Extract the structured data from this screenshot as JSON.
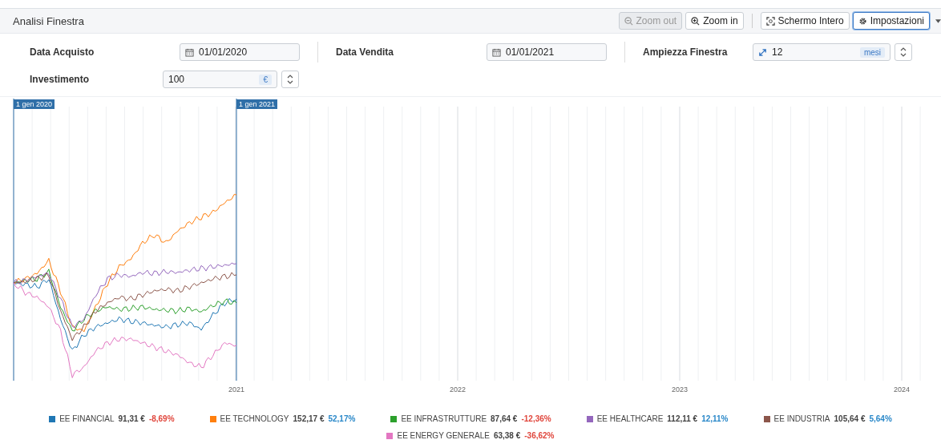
{
  "header": {
    "title": "Analisi Finestra",
    "buttons": [
      {
        "kind": "zoom-out",
        "label": "Zoom out",
        "disabled": true,
        "active": false
      },
      {
        "kind": "zoom-in",
        "label": "Zoom in",
        "disabled": false,
        "active": false
      },
      {
        "kind": "fullscreen",
        "label": "Schermo Intero",
        "disabled": false,
        "active": false
      },
      {
        "kind": "settings",
        "label": "Impostazioni",
        "disabled": false,
        "active": true
      }
    ]
  },
  "form": {
    "purchase": {
      "label": "Data Acquisto",
      "value": "01/01/2020"
    },
    "sale": {
      "label": "Data Vendita",
      "value": "01/01/2021"
    },
    "window": {
      "label": "Ampiezza Finestra",
      "value": "12",
      "unit": "mesi"
    },
    "investment": {
      "label": "Investimento",
      "value": "100",
      "unit": "€"
    }
  },
  "chart": {
    "markers": [
      "1 gen 2020",
      "1 gen 2021"
    ],
    "x_labels": [
      "2021",
      "2022",
      "2023",
      "2024"
    ]
  },
  "legend": [
    {
      "name": "EE FINANCIAL",
      "value": "91,31 €",
      "change": "-8,69%",
      "negative": true,
      "color": "#1f77b4"
    },
    {
      "name": "EE TECHNOLOGY",
      "value": "152,17 €",
      "change": "52,17%",
      "negative": false,
      "color": "#ff7f0e"
    },
    {
      "name": "EE INFRASTRUTTURE",
      "value": "87,64 €",
      "change": "-12,36%",
      "negative": true,
      "color": "#2ca02c"
    },
    {
      "name": "EE HEALTHCARE",
      "value": "112,11 €",
      "change": "12,11%",
      "negative": false,
      "color": "#9467bd"
    },
    {
      "name": "EE INDUSTRIA",
      "value": "105,64 €",
      "change": "5,64%",
      "negative": false,
      "color": "#8c564b"
    },
    {
      "name": "EE ENERGY GENERALE",
      "value": "63,38 €",
      "change": "-36,62%",
      "negative": true,
      "color": "#e377c2"
    }
  ]
}
